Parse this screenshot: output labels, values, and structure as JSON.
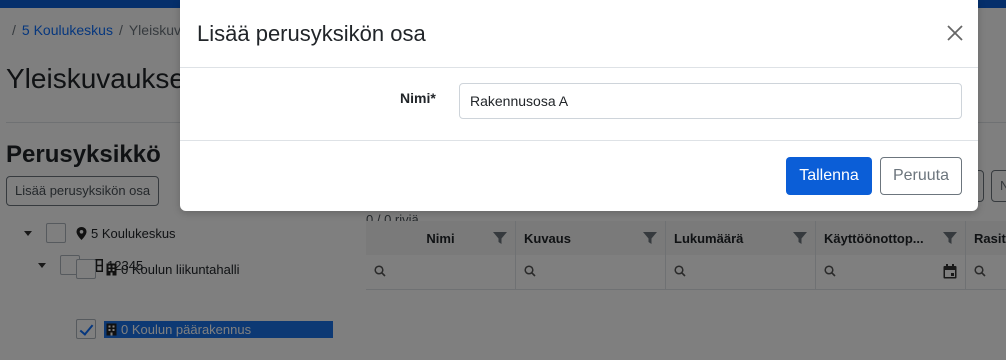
{
  "breadcrumb": {
    "sep": "/",
    "item1": "5 Koulukeskus",
    "item2": "Yleiskuvaukset"
  },
  "page": {
    "title": "Yleiskuvaukset"
  },
  "section": {
    "title": "Perusyksikkö",
    "add_button": "Lisää perusyksikön osa",
    "right_btn2": "N"
  },
  "tree": [
    {
      "label": "5 Koulukeskus",
      "icon": "map-marker-icon"
    },
    {
      "label": "12345",
      "icon": "grid-icon"
    },
    {
      "label": "0 Koulun liikuntahalli",
      "icon": "building-icon"
    },
    {
      "label": "0 Koulun päärakennus",
      "icon": "building-icon",
      "checked": true,
      "selected": true
    }
  ],
  "grid": {
    "row_count": "0 / 0 riviä",
    "columns": [
      "Nimi",
      "Kuvaus",
      "Lukumäärä",
      "Käyttöönottop...",
      "Rasit"
    ]
  },
  "modal": {
    "title": "Lisää perusyksikön osa",
    "field_label": "Nimi*",
    "field_value": "Rakennusosa A",
    "save_label": "Tallenna",
    "cancel_label": "Peruuta"
  },
  "colors": {
    "primary": "#0b5ed7",
    "backdrop": "rgba(0,0,0,0.5)",
    "selected": "#1a73e8"
  }
}
